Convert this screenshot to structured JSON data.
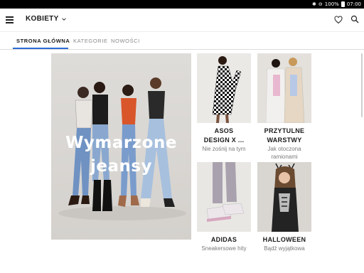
{
  "status_bar": {
    "battery": "100%",
    "time": "07:00"
  },
  "app_bar": {
    "section": "KOBIETY"
  },
  "tabs": [
    {
      "label": "STRONA GŁÓWNA",
      "active": true
    },
    {
      "label": "KATEGORIE",
      "active": false
    },
    {
      "label": "NOWOŚCI",
      "active": false
    }
  ],
  "hero": {
    "line1": "Wymarzone",
    "line2": "jeansy"
  },
  "tiles": [
    {
      "title": "ASOS",
      "title2": "DESIGN X ...",
      "subtitle": "Nie zośnij na tym"
    },
    {
      "title": "PRZYTULNE",
      "title2": "WARSTWY",
      "subtitle": "Jak otoczona",
      "subtitle2": "ramionami"
    },
    {
      "title": "ADIDAS",
      "subtitle": "Sneakersowe hity"
    },
    {
      "title": "HALLOWEEN",
      "subtitle": "Bądź wyjątkowa"
    }
  ],
  "colors": {
    "accent": "#2d6bd4",
    "hero_text": "#ffffff"
  }
}
